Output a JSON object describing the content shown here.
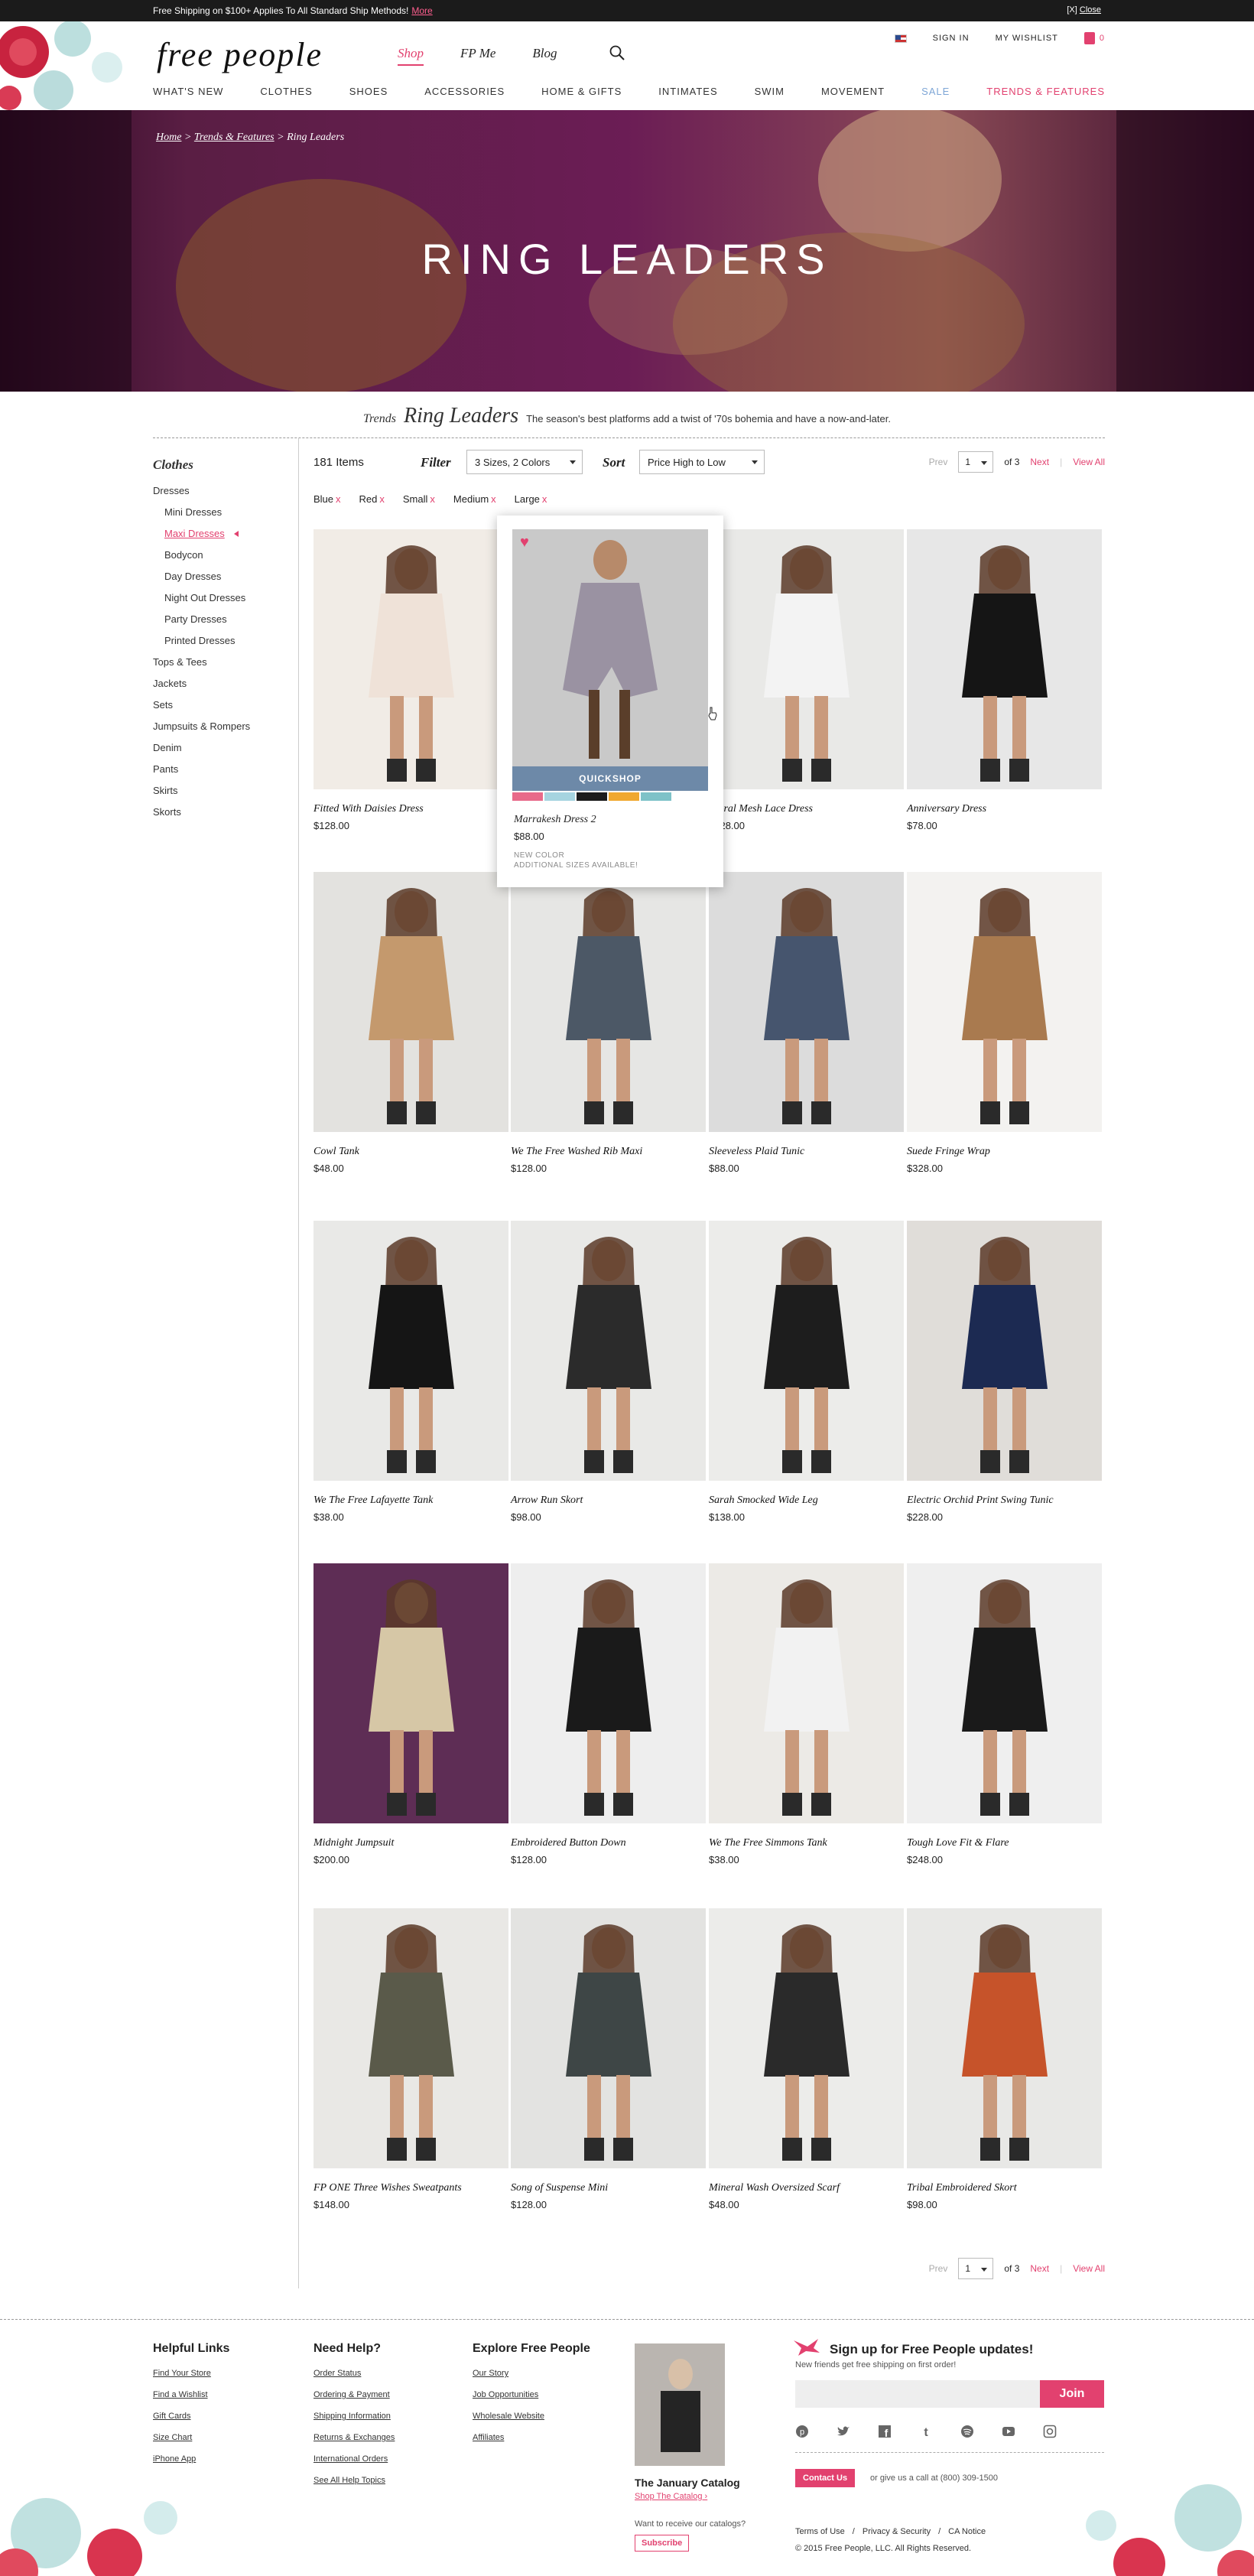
{
  "topbar": {
    "shipping_text": "Free Shipping on $100+ Applies To All Standard Ship Methods!",
    "more": "More",
    "close_x": "[X]",
    "close": "Close"
  },
  "header": {
    "logo": "free people",
    "topnav": [
      "Shop",
      "FP Me",
      "Blog"
    ],
    "utility": {
      "sign_in": "SIGN IN",
      "wishlist": "MY WISHLIST",
      "bag_count": "0"
    },
    "mainnav": [
      "WHAT'S NEW",
      "CLOTHES",
      "SHOES",
      "ACCESSORIES",
      "HOME & GIFTS",
      "INTIMATES",
      "SWIM",
      "MOVEMENT",
      "SALE",
      "TRENDS & FEATURES"
    ]
  },
  "hero": {
    "breadcrumb": [
      "Home",
      "Trends & Features",
      "Ring Leaders"
    ],
    "title": "RING LEADERS"
  },
  "trend": {
    "label": "Trends",
    "name": "Ring Leaders",
    "desc": "The season's best platforms add a twist of '70s bohemia and have a now-and-later."
  },
  "sidebar": {
    "heading": "Clothes",
    "items": [
      {
        "label": "Dresses",
        "level": 0
      },
      {
        "label": "Mini Dresses",
        "level": 1
      },
      {
        "label": "Maxi Dresses",
        "level": 1,
        "selected": true
      },
      {
        "label": "Bodycon",
        "level": 1
      },
      {
        "label": "Day Dresses",
        "level": 1
      },
      {
        "label": "Night Out Dresses",
        "level": 1
      },
      {
        "label": "Party Dresses",
        "level": 1
      },
      {
        "label": "Printed Dresses",
        "level": 1
      },
      {
        "label": "Tops & Tees",
        "level": 0
      },
      {
        "label": "Jackets",
        "level": 0
      },
      {
        "label": "Sets",
        "level": 0
      },
      {
        "label": "Jumpsuits & Rompers",
        "level": 0
      },
      {
        "label": "Denim",
        "level": 0
      },
      {
        "label": "Pants",
        "level": 0
      },
      {
        "label": "Skirts",
        "level": 0
      },
      {
        "label": "Skorts",
        "level": 0
      }
    ]
  },
  "toolbar": {
    "count": "181 Items",
    "filter_label": "Filter",
    "filter_value": "3 Sizes, 2 Colors",
    "sort_label": "Sort",
    "sort_value": "Price High to Low",
    "prev": "Prev",
    "page": "1",
    "of": "of 3",
    "next": "Next",
    "view_all": "View All"
  },
  "filters": [
    "Blue",
    "Red",
    "Small",
    "Medium",
    "Large"
  ],
  "filter_x": "x",
  "products": [
    {
      "name": "Fitted With Daisies Dress",
      "price": "$128.00"
    },
    {
      "name": "Marrakesh Dress 2",
      "price": "$88.00"
    },
    {
      "name": "Floral Mesh Lace Dress",
      "price": "$128.00"
    },
    {
      "name": "Anniversary Dress",
      "price": "$78.00"
    },
    {
      "name": "Cowl Tank",
      "price": "$48.00"
    },
    {
      "name": "We The Free Washed Rib Maxi",
      "price": "$128.00"
    },
    {
      "name": "Sleeveless Plaid Tunic",
      "price": "$88.00"
    },
    {
      "name": "Suede Fringe Wrap",
      "price": "$328.00"
    },
    {
      "name": "We The Free Lafayette Tank",
      "price": "$38.00"
    },
    {
      "name": "Arrow Run Skort",
      "price": "$98.00"
    },
    {
      "name": "Sarah Smocked Wide Leg",
      "price": "$138.00"
    },
    {
      "name": "Electric Orchid Print Swing Tunic",
      "price": "$228.00"
    },
    {
      "name": "Midnight Jumpsuit",
      "price": "$200.00"
    },
    {
      "name": "Embroidered Button Down",
      "price": "$128.00"
    },
    {
      "name": "We The Free Simmons Tank",
      "price": "$38.00"
    },
    {
      "name": "Tough Love Fit & Flare",
      "price": "$248.00"
    },
    {
      "name": "FP ONE Three Wishes Sweatpants",
      "price": "$148.00"
    },
    {
      "name": "Song of Suspense Mini",
      "price": "$128.00"
    },
    {
      "name": "Mineral Wash Oversized Scarf",
      "price": "$48.00"
    },
    {
      "name": "Tribal Embroidered Skort",
      "price": "$98.00"
    }
  ],
  "product_colors": [
    "#f1ece6",
    "#d9d6d3",
    "#e9e9e7",
    "#e7e7e7",
    "#e3e2df",
    "#e6e6e4",
    "#dcdcdc",
    "#f3f2f0",
    "#e9e9e7",
    "#e9e9e7",
    "#ececea",
    "#e0ddd9",
    "#5e2d55",
    "#eeeeee",
    "#eceae6",
    "#efefef",
    "#e9e8e5",
    "#e3e3e1",
    "#ececea",
    "#e8e8e6"
  ],
  "outfit_colors": [
    "#efe2d8",
    "#9d96a0",
    "#f3f3f3",
    "#151515",
    "#c4996d",
    "#4c5866",
    "#46556e",
    "#a97a4f",
    "#151515",
    "#2b2b2b",
    "#1d1d1d",
    "#1c2a52",
    "#d6c7a6",
    "#1a1a1a",
    "#f2f2f2",
    "#1a1a1a",
    "#5a5a4a",
    "#3e4646",
    "#2a2a2a",
    "#c6532a"
  ],
  "quickshop": {
    "label": "QUICKSHOP",
    "name": "Marrakesh Dress 2",
    "price": "$88.00",
    "note1": "NEW COLOR",
    "note2": "ADDITIONAL SIZES AVAILABLE!",
    "swatches": [
      "#e86a8a",
      "#a6d4e0",
      "#1c1c1c",
      "#f0a830",
      "#7ec2c8"
    ]
  },
  "footer": {
    "helpful": {
      "title": "Helpful Links",
      "links": [
        "Find Your Store",
        "Find a Wishlist",
        "Gift Cards",
        "Size Chart",
        "iPhone App"
      ]
    },
    "help": {
      "title": "Need Help?",
      "links": [
        "Order Status",
        "Ordering & Payment",
        "Shipping Information",
        "Returns & Exchanges",
        "International Orders",
        "See All Help Topics"
      ]
    },
    "explore": {
      "title": "Explore Free People",
      "links": [
        "Our Story",
        "Job Opportunities",
        "Wholesale Website",
        "Affiliates"
      ]
    },
    "catalog": {
      "title": "The January Catalog",
      "link": "Shop The Catalog ›",
      "question": "Want to receive our catalogs?",
      "subscribe": "Subscribe"
    },
    "signup": {
      "title": "Sign up for Free People updates!",
      "sub": "New friends get free shipping on first order!",
      "join": "Join"
    },
    "socials": [
      "pinterest-icon",
      "twitter-icon",
      "facebook-icon",
      "tumblr-icon",
      "spotify-icon",
      "youtube-icon",
      "instagram-icon"
    ],
    "contact": {
      "button": "Contact Us",
      "text": "or give us a call at (800) 309-1500"
    },
    "legal": [
      "Terms of Use",
      "/",
      "Privacy & Security",
      "/",
      "CA Notice"
    ],
    "copyright": "© 2015 Free People, LLC. All Rights Reserved."
  },
  "colors": {
    "accent": "#e2416f",
    "quickshop": "#6d89a8",
    "topbar": "#1b1b1b",
    "hero": "#3b0b2c"
  }
}
